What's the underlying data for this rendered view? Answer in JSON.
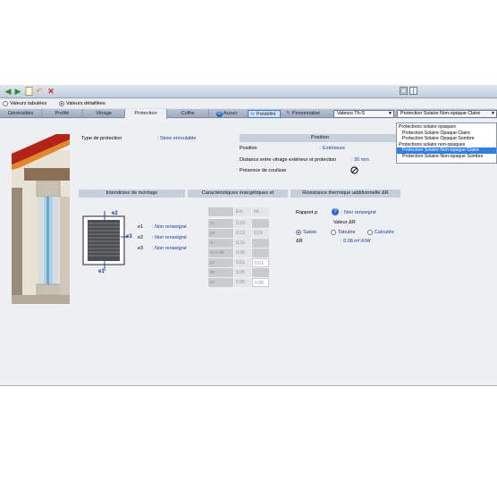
{
  "toolbar": {
    "icons": [
      "back-arrow-icon",
      "forward-arrow-icon",
      "new-document-icon",
      "undo-icon",
      "delete-icon",
      "window-icon",
      "window-icon"
    ]
  },
  "view_mode": {
    "tabulated": "Valeurs tabulées",
    "detailed": "Valeurs détaillées",
    "selected": "detailed"
  },
  "tabs": [
    {
      "label": "Généralités"
    },
    {
      "label": "Profilé"
    },
    {
      "label": "Vitrage"
    },
    {
      "label": "Protection"
    },
    {
      "label": "Coffre"
    }
  ],
  "mode_buttons": {
    "aucun": "Aucun",
    "predefini": "Prédéfini",
    "personnalise": "Personnalisé"
  },
  "combo_values": "Valeurs Th-S",
  "combo_protection": "Protection Solaire Non-opaque Claire",
  "dropdown": {
    "items": [
      {
        "label": "Protections solaire opaques",
        "type": "group"
      },
      {
        "label": "Protection Solaire Opaque Claire",
        "type": "item"
      },
      {
        "label": "Protection Solaire Opaque Sombre",
        "type": "item"
      },
      {
        "label": "Protections solaire non-opaques",
        "type": "group"
      },
      {
        "label": "Protection Solaire Non-opaque Claire",
        "type": "item",
        "selected": true
      },
      {
        "label": "Protection Solaire Non-opaque Sombre",
        "type": "item"
      }
    ]
  },
  "protection": {
    "type_label": "Type de protection",
    "type_value": ": Store enroulable",
    "position_header": "Position",
    "position_label": "Position",
    "position_value": ": Extérieure",
    "distance_label": "Distance entre vitrage extérieur et protection",
    "distance_value": ": 30 mm",
    "coulisse_label": "Présence de coulisse"
  },
  "sections": {
    "montage": "Intersticies de montage",
    "energetic": "Caractéristiques énergétiques et",
    "resistance": "Résistance thermique additionnelle ΔR"
  },
  "gaps": [
    {
      "label": "e1",
      "value": ": Non renseigné"
    },
    {
      "label": "e2",
      "value": ": Non renseigné"
    },
    {
      "label": "e3",
      "value": ": Non renseigné"
    }
  ],
  "gap_diagram_labels": {
    "e1": "e1",
    "e2": "e2",
    "e3": "e3"
  },
  "energetic_table": {
    "headers": [
      "Ext.",
      "Int."
    ],
    "rows": [
      {
        "name": "τe",
        "ext": "0.19",
        "int": ""
      },
      {
        "name": "ρe",
        "ext": "0.23",
        "int": "0.23"
      },
      {
        "name": "τv",
        "ext": "0.16",
        "int": ""
      },
      {
        "name": "τv,n-dif",
        "ext": "0.00",
        "int": ""
      },
      {
        "name": "ρv",
        "ext": "0.61",
        "int": "0.61"
      },
      {
        "name": "αe",
        "ext": "0.05",
        "int": ""
      },
      {
        "name": "εe",
        "ext": "0.90",
        "int": "0.90"
      }
    ]
  },
  "resistance": {
    "rapport_label": "Rapport p",
    "rapport_value": ": Non renseigné",
    "valeur_label": "Valeur ΔR",
    "options": [
      "Saisie",
      "Tabulée",
      "Calculée"
    ],
    "selected_option": "Saisie",
    "delta_label": "ΔR",
    "delta_value": ": 0.08 m².K/W"
  }
}
